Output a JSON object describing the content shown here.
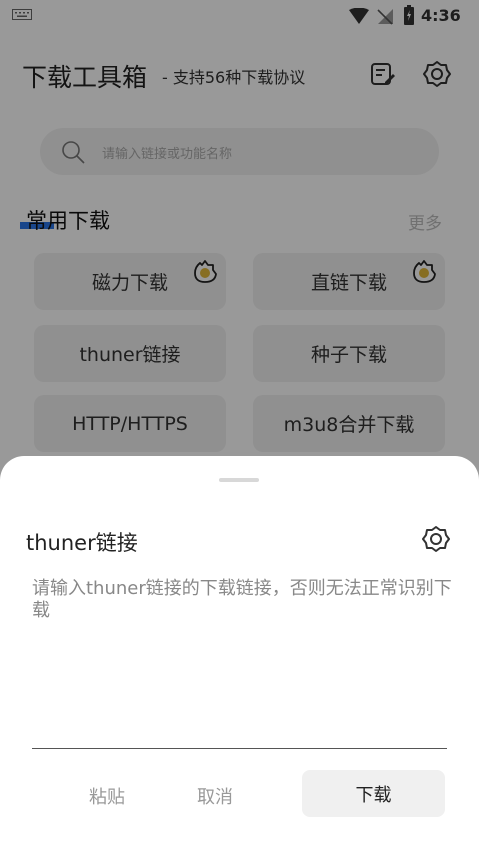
{
  "status_bar": {
    "time": "4:36"
  },
  "header": {
    "title": "下载工具箱",
    "subtitle": "- 支持56种下载协议"
  },
  "search": {
    "placeholder": "请输入链接或功能名称"
  },
  "section": {
    "title": "常用下载",
    "more_label": "更多"
  },
  "tiles": [
    {
      "label": "磁力下载",
      "badge": "reward-icon"
    },
    {
      "label": "直链下载",
      "badge": "reward-icon"
    },
    {
      "label": "thuner链接"
    },
    {
      "label": "种子下载"
    },
    {
      "label": "HTTP/HTTPS"
    },
    {
      "label": "m3u8合并下载"
    }
  ],
  "dialog": {
    "title": "thuner链接",
    "message": "请输入thuner链接的下载链接，否则无法正常识别下载",
    "input_value": "",
    "paste_label": "粘贴",
    "cancel_label": "取消",
    "download_label": "下载"
  },
  "colors": {
    "accent": "#2a76e8",
    "badge": "#e2b73a",
    "tile_bg": "#f0f0f0",
    "overlay": "rgba(0,0,0,0.4)"
  }
}
